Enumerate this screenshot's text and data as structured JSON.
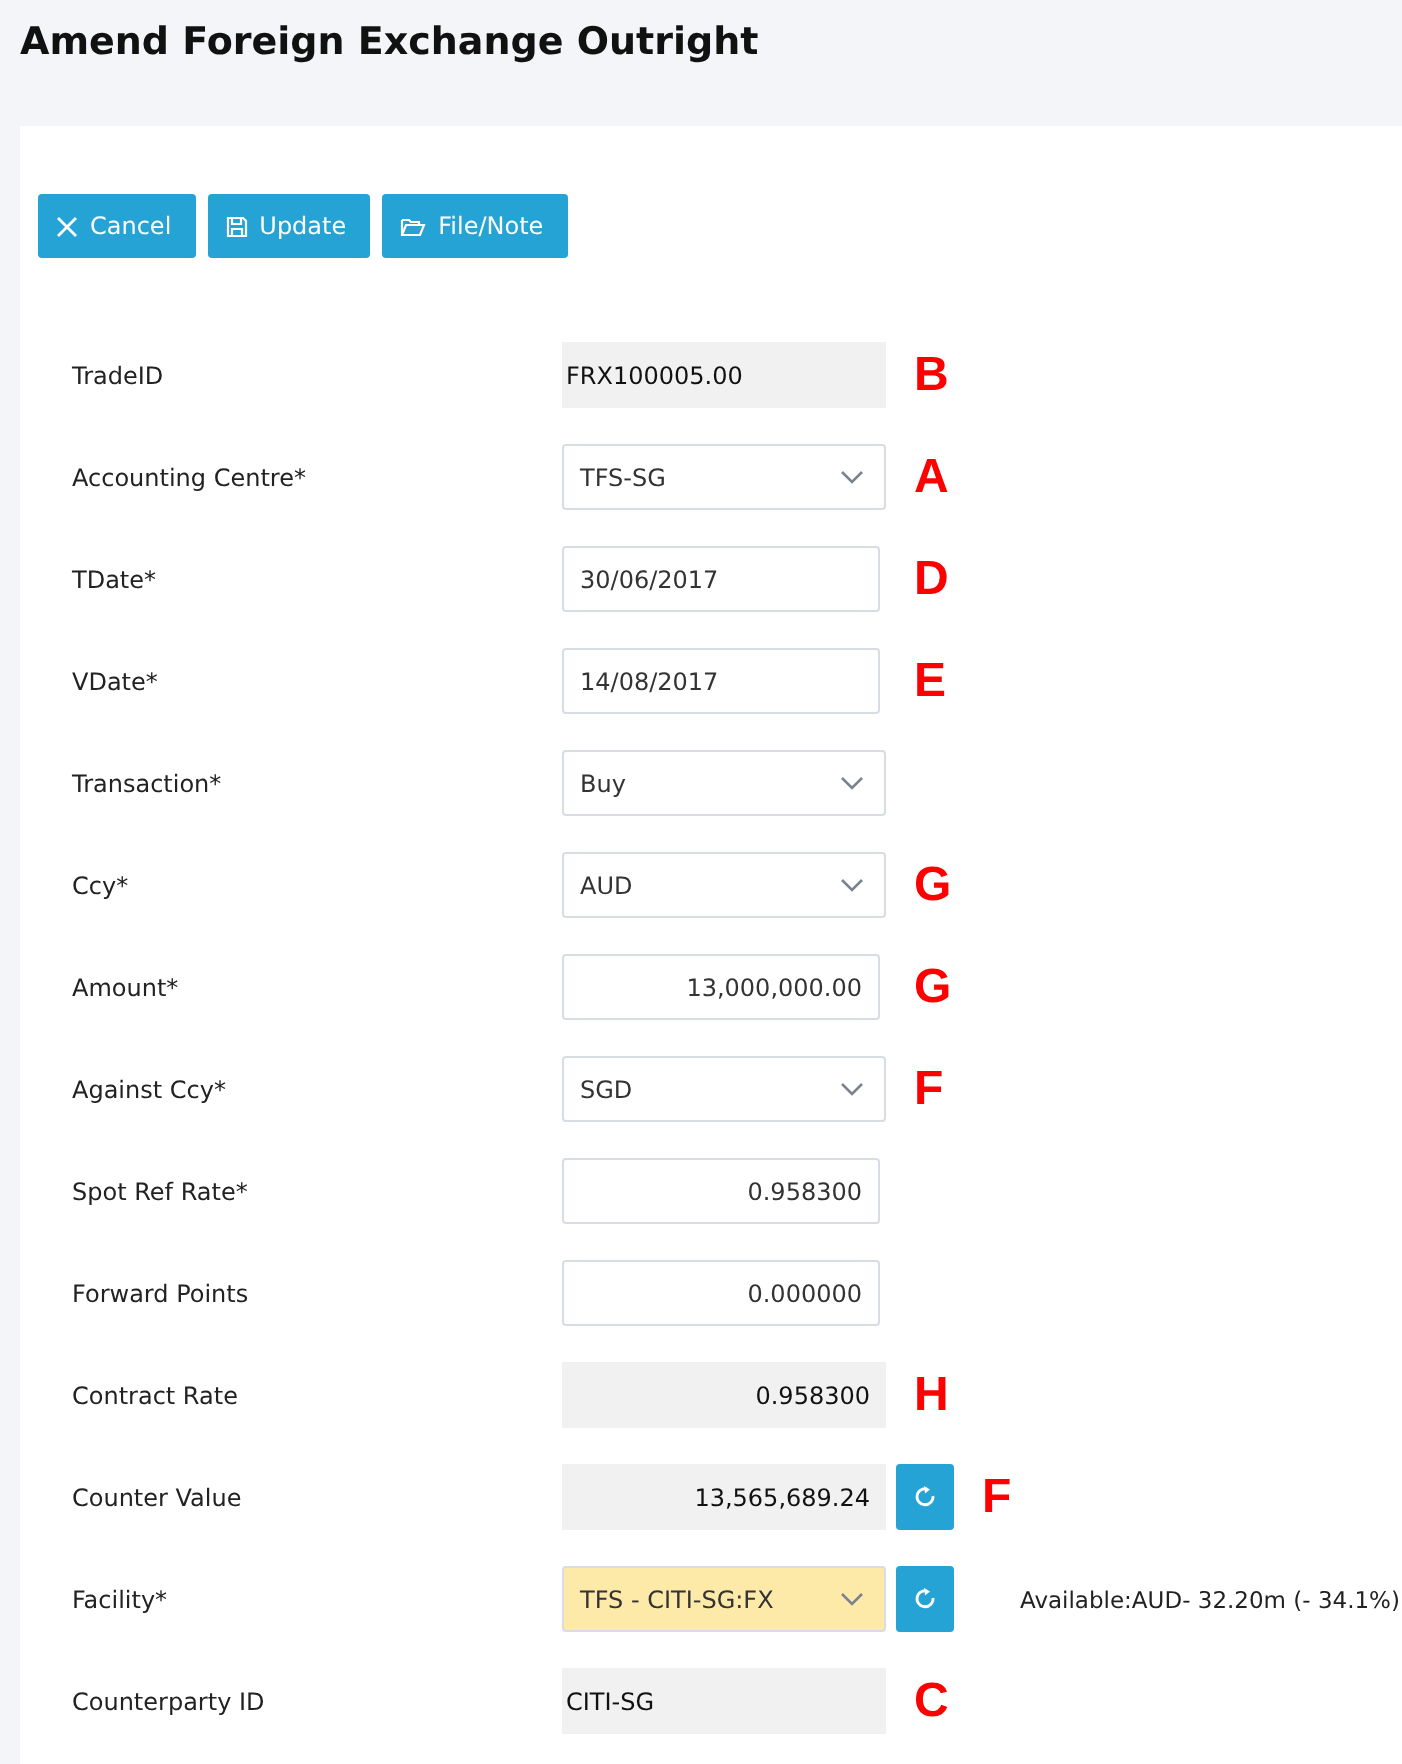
{
  "title": "Amend Foreign Exchange Outright",
  "buttons": [
    {
      "label": "Cancel"
    },
    {
      "label": "Update"
    },
    {
      "label": "File/Note"
    }
  ],
  "fields": [
    {
      "label": "TradeID",
      "kind": "readonly",
      "value": "FRX100005.00",
      "marker": "B"
    },
    {
      "label": "Accounting Centre*",
      "kind": "select",
      "value": "TFS-SG",
      "marker": "A"
    },
    {
      "label": "TDate*",
      "kind": "input",
      "value": "30/06/2017",
      "marker": "D"
    },
    {
      "label": "VDate*",
      "kind": "input",
      "value": "14/08/2017",
      "marker": "E"
    },
    {
      "label": "Transaction*",
      "kind": "select",
      "value": "Buy"
    },
    {
      "label": "Ccy*",
      "kind": "select",
      "value": "AUD",
      "marker": "G"
    },
    {
      "label": "Amount*",
      "kind": "numinput",
      "value": "13,000,000.00",
      "marker": "G"
    },
    {
      "label": "Against Ccy*",
      "kind": "select",
      "value": "SGD",
      "marker": "F"
    },
    {
      "label": "Spot Ref Rate*",
      "kind": "numinput",
      "value": "0.958300"
    },
    {
      "label": "Forward Points",
      "kind": "numinput",
      "value": "0.000000"
    },
    {
      "label": "Contract Rate",
      "kind": "numreadonly",
      "value": "0.958300",
      "marker": "H"
    },
    {
      "label": "Counter Value",
      "kind": "numreadonly",
      "value": "13,565,689.24",
      "refresh": true,
      "marker": "F"
    },
    {
      "label": "Facility*",
      "kind": "select",
      "value": "TFS - CITI-SG:FX",
      "highlighted": true,
      "refresh": true,
      "note": "Available:AUD- 32.20m (- 34.1%)"
    },
    {
      "label": "Counterparty ID",
      "kind": "readonly",
      "value": "CITI-SG",
      "marker": "C"
    }
  ]
}
